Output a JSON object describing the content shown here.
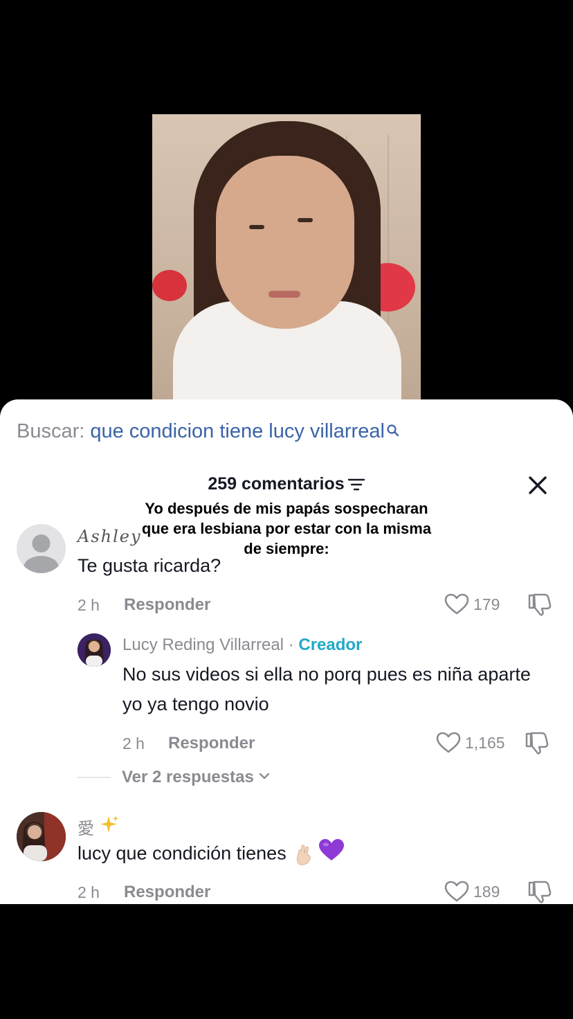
{
  "search": {
    "prefix": "Buscar:",
    "query": "que condicion tiene lucy villarreal"
  },
  "header": {
    "comments_count": "259 comentarios"
  },
  "caption": {
    "text": "Yo después de mis papás sospecharan que era lesbiana por estar con la misma de siempre:"
  },
  "comments": [
    {
      "author": "Ashley",
      "text": "Te gusta ricarda?",
      "time": "2 h",
      "reply_label": "Responder",
      "likes": "179"
    },
    {
      "author": "Lucy Reding Villarreal",
      "separator": "·",
      "role": "Creador",
      "text": "No sus videos si ella no porq pues es niña aparte yo ya tengo novio",
      "time": "2 h",
      "reply_label": "Responder",
      "likes": "1,165"
    },
    {
      "author": "愛",
      "text": "lucy que condición tienes",
      "time": "2 h",
      "reply_label": "Responder",
      "likes": "189"
    }
  ],
  "view_replies": {
    "label": "Ver 2 respuestas"
  },
  "icons": {
    "search": "search-icon",
    "filter": "filter-icon",
    "close": "close-icon",
    "like": "heart-outline-icon",
    "dislike": "thumbs-down-icon",
    "chevron": "chevron-down-icon",
    "sparkles": "sparkles-icon",
    "hand": "crossed-fingers-icon",
    "heart": "purple-heart-icon"
  },
  "colors": {
    "accent_link": "#3a63a8",
    "creator": "#20a9c8",
    "muted": "#8a8b91",
    "text": "#161823",
    "purple_heart": "#8e3ad6"
  }
}
